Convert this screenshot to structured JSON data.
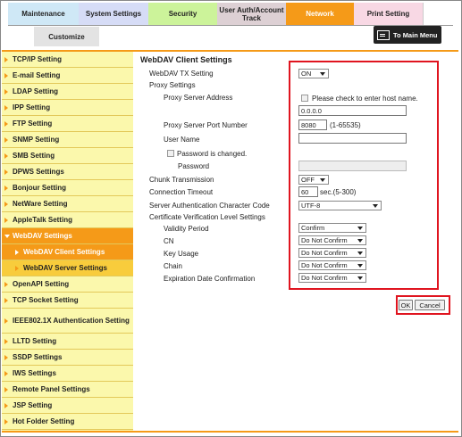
{
  "tabs": {
    "maintenance": "Maintenance",
    "system": "System Settings",
    "security": "Security",
    "auth": "User Auth/Account Track",
    "network": "Network",
    "print": "Print Setting",
    "customize": "Customize",
    "to_main": "To Main Menu"
  },
  "sidebar": {
    "items": [
      "TCP/IP Setting",
      "E-mail Setting",
      "LDAP Setting",
      "IPP Setting",
      "FTP Setting",
      "SNMP Setting",
      "SMB Setting",
      "DPWS Settings",
      "Bonjour Setting",
      "NetWare Setting",
      "AppleTalk Setting",
      "WebDAV Settings",
      "WebDAV Client Settings",
      "WebDAV Server Settings",
      "OpenAPI Setting",
      "TCP Socket Setting",
      "IEEE802.1X Authentication Setting",
      "LLTD Setting",
      "SSDP Settings",
      "IWS Settings",
      "Remote Panel Settings",
      "JSP Setting",
      "Hot Folder Setting"
    ]
  },
  "form": {
    "title": "WebDAV Client Settings",
    "tx_label": "WebDAV TX Setting",
    "tx_value": "ON",
    "proxy_label": "Proxy Settings",
    "proxy_addr_label": "Proxy Server Address",
    "host_check_label": "Please check to enter host name.",
    "proxy_addr_value": "0.0.0.0",
    "proxy_port_label": "Proxy Server Port Number",
    "proxy_port_value": "8080",
    "proxy_port_range": "(1-65535)",
    "user_name_label": "User Name",
    "user_name_value": "",
    "pw_changed_label": "Password is changed.",
    "password_label": "Password",
    "chunk_label": "Chunk Transmission",
    "chunk_value": "OFF",
    "timeout_label": "Connection Timeout",
    "timeout_value": "60",
    "timeout_unit": "sec.(5-300)",
    "charcode_label": "Server Authentication Character Code",
    "charcode_value": "UTF-8",
    "cert_label": "Certificate Verification Level Settings",
    "validity_label": "Validity Period",
    "validity_value": "Confirm",
    "cn_label": "CN",
    "cn_value": "Do Not Confirm",
    "keyusage_label": "Key Usage",
    "keyusage_value": "Do Not Confirm",
    "chain_label": "Chain",
    "chain_value": "Do Not Confirm",
    "expiry_label": "Expiration Date Confirmation",
    "expiry_value": "Do Not Confirm",
    "ok": "OK",
    "cancel": "Cancel"
  }
}
